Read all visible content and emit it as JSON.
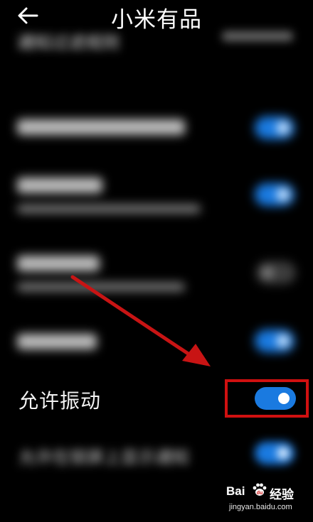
{
  "header": {
    "title": "小米有品",
    "back_icon": "arrow-left-icon"
  },
  "partial_section_title": "通知过滤规则",
  "settings": {
    "vibrate_label": "允许振动",
    "vibrate_enabled": true,
    "partial_row_label": "允许在锁屏上显示通知"
  },
  "annotation": {
    "highlight_color": "#d01010",
    "arrow_color": "#c81414"
  },
  "watermark": {
    "brand_left": "Bai",
    "brand_right": "经验",
    "url": "jingyan.baidu.com"
  },
  "colors": {
    "toggle_on": "#1a7ae0",
    "background": "#000000"
  }
}
